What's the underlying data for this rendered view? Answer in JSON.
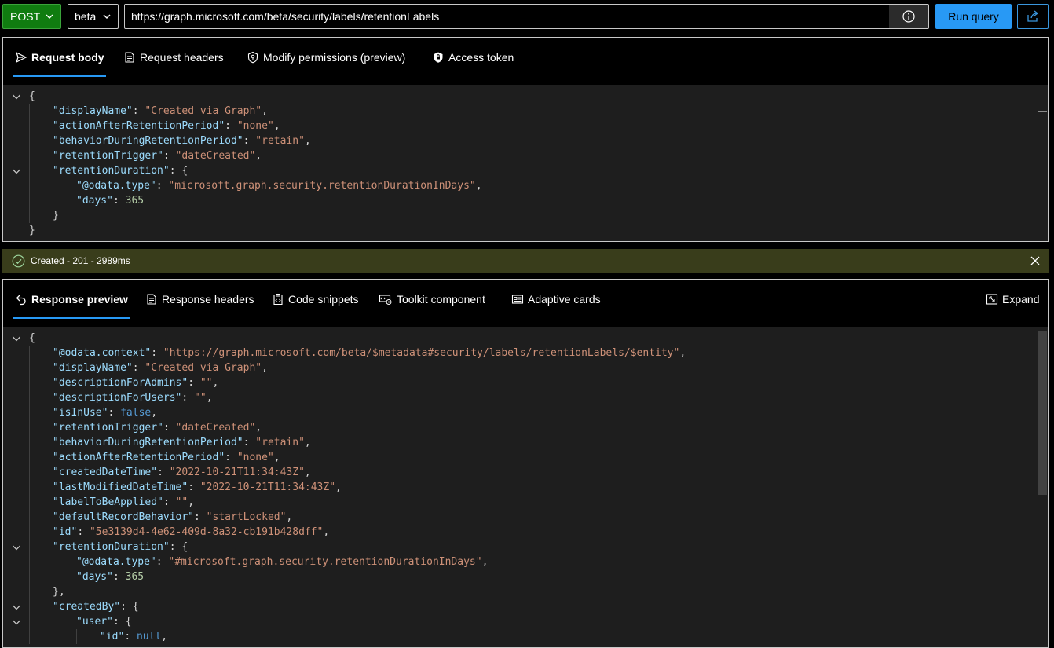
{
  "query": {
    "method": "POST",
    "version": "beta",
    "url": "https://graph.microsoft.com/beta/security/labels/retentionLabels",
    "run_label": "Run query"
  },
  "request": {
    "tabs": [
      {
        "label": "Request body",
        "icon": "send-icon"
      },
      {
        "label": "Request headers",
        "icon": "document-icon"
      },
      {
        "label": "Modify permissions (preview)",
        "icon": "shield-key-icon"
      },
      {
        "label": "Access token",
        "icon": "lock-icon"
      }
    ],
    "lines": [
      [
        [
          "p",
          "{"
        ]
      ],
      [
        [
          "k",
          "\"displayName\""
        ],
        [
          "p",
          ": "
        ],
        [
          "s",
          "\"Created via Graph\""
        ],
        [
          "p",
          ","
        ]
      ],
      [
        [
          "k",
          "\"actionAfterRetentionPeriod\""
        ],
        [
          "p",
          ": "
        ],
        [
          "s",
          "\"none\""
        ],
        [
          "p",
          ","
        ]
      ],
      [
        [
          "k",
          "\"behaviorDuringRetentionPeriod\""
        ],
        [
          "p",
          ": "
        ],
        [
          "s",
          "\"retain\""
        ],
        [
          "p",
          ","
        ]
      ],
      [
        [
          "k",
          "\"retentionTrigger\""
        ],
        [
          "p",
          ": "
        ],
        [
          "s",
          "\"dateCreated\""
        ],
        [
          "p",
          ","
        ]
      ],
      [
        [
          "k",
          "\"retentionDuration\""
        ],
        [
          "p",
          ": {"
        ]
      ],
      [
        [
          "k",
          "\"@odata.type\""
        ],
        [
          "p",
          ": "
        ],
        [
          "s",
          "\"microsoft.graph.security.retentionDurationInDays\""
        ],
        [
          "p",
          ","
        ]
      ],
      [
        [
          "k",
          "\"days\""
        ],
        [
          "p",
          ": "
        ],
        [
          "n",
          "365"
        ]
      ],
      [
        [
          "p",
          "}"
        ]
      ],
      [
        [
          "p",
          "}"
        ]
      ]
    ]
  },
  "status": {
    "text": "Created - 201 - 2989ms",
    "color": "#393d1b"
  },
  "response": {
    "tabs": [
      {
        "label": "Response preview",
        "icon": "undo-arrow-icon"
      },
      {
        "label": "Response headers",
        "icon": "document-icon"
      },
      {
        "label": "Code snippets",
        "icon": "clipboard-code-icon"
      },
      {
        "label": "Toolkit component",
        "icon": "toolkit-icon"
      },
      {
        "label": "Adaptive cards",
        "icon": "card-icon"
      }
    ],
    "expand_label": "Expand",
    "lines": [
      [
        [
          "p",
          "{"
        ]
      ],
      [
        [
          "k",
          "\"@odata.context\""
        ],
        [
          "p",
          ": "
        ],
        [
          "s",
          "\""
        ],
        [
          "lnk",
          "https://graph.microsoft.com/beta/$metadata#security/labels/retentionLabels/$entity"
        ],
        [
          "s",
          "\""
        ],
        [
          "p",
          ","
        ]
      ],
      [
        [
          "k",
          "\"displayName\""
        ],
        [
          "p",
          ": "
        ],
        [
          "s",
          "\"Created via Graph\""
        ],
        [
          "p",
          ","
        ]
      ],
      [
        [
          "k",
          "\"descriptionForAdmins\""
        ],
        [
          "p",
          ": "
        ],
        [
          "s",
          "\"\""
        ],
        [
          "p",
          ","
        ]
      ],
      [
        [
          "k",
          "\"descriptionForUsers\""
        ],
        [
          "p",
          ": "
        ],
        [
          "s",
          "\"\""
        ],
        [
          "p",
          ","
        ]
      ],
      [
        [
          "k",
          "\"isInUse\""
        ],
        [
          "p",
          ": "
        ],
        [
          "b",
          "false"
        ],
        [
          "p",
          ","
        ]
      ],
      [
        [
          "k",
          "\"retentionTrigger\""
        ],
        [
          "p",
          ": "
        ],
        [
          "s",
          "\"dateCreated\""
        ],
        [
          "p",
          ","
        ]
      ],
      [
        [
          "k",
          "\"behaviorDuringRetentionPeriod\""
        ],
        [
          "p",
          ": "
        ],
        [
          "s",
          "\"retain\""
        ],
        [
          "p",
          ","
        ]
      ],
      [
        [
          "k",
          "\"actionAfterRetentionPeriod\""
        ],
        [
          "p",
          ": "
        ],
        [
          "s",
          "\"none\""
        ],
        [
          "p",
          ","
        ]
      ],
      [
        [
          "k",
          "\"createdDateTime\""
        ],
        [
          "p",
          ": "
        ],
        [
          "s",
          "\"2022-10-21T11:34:43Z\""
        ],
        [
          "p",
          ","
        ]
      ],
      [
        [
          "k",
          "\"lastModifiedDateTime\""
        ],
        [
          "p",
          ": "
        ],
        [
          "s",
          "\"2022-10-21T11:34:43Z\""
        ],
        [
          "p",
          ","
        ]
      ],
      [
        [
          "k",
          "\"labelToBeApplied\""
        ],
        [
          "p",
          ": "
        ],
        [
          "s",
          "\"\""
        ],
        [
          "p",
          ","
        ]
      ],
      [
        [
          "k",
          "\"defaultRecordBehavior\""
        ],
        [
          "p",
          ": "
        ],
        [
          "s",
          "\"startLocked\""
        ],
        [
          "p",
          ","
        ]
      ],
      [
        [
          "k",
          "\"id\""
        ],
        [
          "p",
          ": "
        ],
        [
          "s",
          "\"5e3139d4-4e62-409d-8a32-cb191b428dff\""
        ],
        [
          "p",
          ","
        ]
      ],
      [
        [
          "k",
          "\"retentionDuration\""
        ],
        [
          "p",
          ": {"
        ]
      ],
      [
        [
          "k",
          "\"@odata.type\""
        ],
        [
          "p",
          ": "
        ],
        [
          "s",
          "\"#microsoft.graph.security.retentionDurationInDays\""
        ],
        [
          "p",
          ","
        ]
      ],
      [
        [
          "k",
          "\"days\""
        ],
        [
          "p",
          ": "
        ],
        [
          "n",
          "365"
        ]
      ],
      [
        [
          "p",
          "},"
        ]
      ],
      [
        [
          "k",
          "\"createdBy\""
        ],
        [
          "p",
          ": {"
        ]
      ],
      [
        [
          "k",
          "\"user\""
        ],
        [
          "p",
          ": {"
        ]
      ],
      [
        [
          "k",
          "\"id\""
        ],
        [
          "p",
          ": "
        ],
        [
          "b",
          "null"
        ],
        [
          "p",
          ","
        ]
      ]
    ]
  }
}
